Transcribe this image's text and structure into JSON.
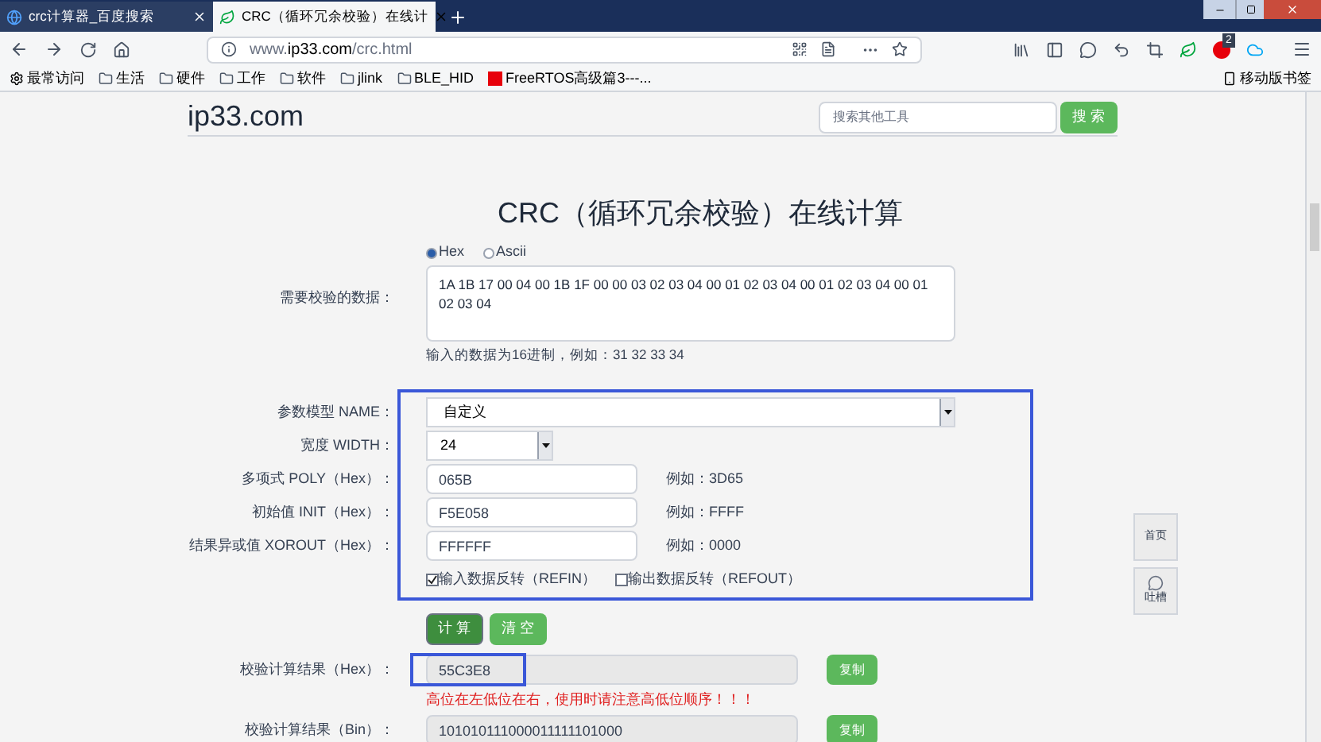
{
  "browser": {
    "tabs": [
      {
        "title": "crc计算器_百度搜索",
        "selected": false
      },
      {
        "title": "CRC（循环冗余校验）在线计",
        "selected": true
      }
    ],
    "address": {
      "prefix": "www.",
      "domain": "ip33.com",
      "path": "/crc.html"
    },
    "bookmarks": [
      {
        "label": "最常访问",
        "kind": "settings"
      },
      {
        "label": "生活",
        "kind": "folder"
      },
      {
        "label": "硬件",
        "kind": "folder"
      },
      {
        "label": "工作",
        "kind": "folder"
      },
      {
        "label": "软件",
        "kind": "folder"
      },
      {
        "label": "jlink",
        "kind": "folder"
      },
      {
        "label": "BLE_HID",
        "kind": "folder"
      },
      {
        "label": "FreeRTOS高级篇3---...",
        "kind": "site"
      }
    ],
    "mobile_bookmarks": "移动版书签",
    "badge": "2"
  },
  "page": {
    "site_name": "ip33.com",
    "search": {
      "placeholder": "搜索其他工具"
    },
    "search_button": "搜 索",
    "title": "CRC（循环冗余校验）在线计算",
    "formats": [
      {
        "label": "Hex",
        "selected": true
      },
      {
        "label": "Ascii",
        "selected": false
      }
    ],
    "data": {
      "label": "需要校验的数据：",
      "value": "1A 1B 17 00 04 00 1B 1F 00 00 03 02 03 04 00 01 02 03 04 00 01 02 03 04 00 01 02 03 04",
      "hint": "输入的数据为16进制，例如：31 32 33 34"
    },
    "params": [
      {
        "kind": "select",
        "label": "参数模型 NAME：",
        "value": "自定义"
      },
      {
        "kind": "small-select",
        "label": "宽度 WIDTH：",
        "value": "24"
      },
      {
        "kind": "input",
        "label": "多项式 POLY（Hex）：",
        "value": "065B",
        "example": "例如：3D65"
      },
      {
        "kind": "input",
        "label": "初始值 INIT（Hex）：",
        "value": "F5E058",
        "example": "例如：FFFF"
      },
      {
        "kind": "input",
        "label": "结果异或值 XOROUT（Hex）：",
        "value": "FFFFFF",
        "example": "例如：0000"
      }
    ],
    "options": [
      {
        "label": "输入数据反转（REFIN）",
        "checked": true
      },
      {
        "label": "输出数据反转（REFOUT）",
        "checked": false
      }
    ],
    "buttons": [
      {
        "label": "计 算",
        "selected": true
      },
      {
        "label": "清 空",
        "selected": false
      }
    ],
    "results": [
      {
        "label": "校验计算结果（Hex）：",
        "value": "55C3E8",
        "copy": "复制"
      },
      {
        "label": "校验计算结果（Bin）：",
        "value": "101010111000011111101000",
        "copy": "复制"
      }
    ],
    "warning": "高位在左低位在右，使用时请注意高低位顺序！！！",
    "side_buttons": [
      {
        "label": "首页",
        "kind": "home"
      },
      {
        "label": "吐槽",
        "kind": "chat"
      }
    ]
  }
}
